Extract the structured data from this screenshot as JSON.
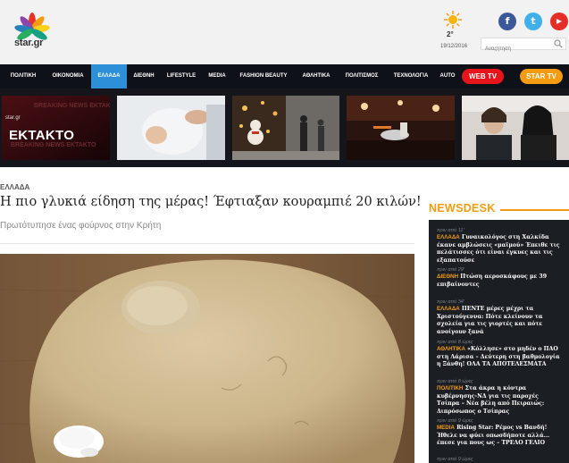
{
  "header": {
    "logo_text": "star.gr",
    "weather": {
      "temp": "2°",
      "date": "19/12/2016"
    },
    "social": {
      "facebook": "f",
      "twitter": "t",
      "youtube": "▶"
    },
    "search": {
      "placeholder": "Αναζήτηση"
    }
  },
  "nav": {
    "items": [
      "ΠΟΛΙΤΙΚΗ",
      "ΟΙΚΟΝΟΜΙΑ",
      "ΕΛΛΑΔΑ",
      "ΔΙΕΘΝΗ",
      "LIFESTYLE",
      "MEDIA",
      "FASHION BEAUTY",
      "ΑΘΛΗΤΙΚΑ",
      "ΠΟΛΙΤΙΣΜΟΣ",
      "ΤΕΧΝΟΛΟΓΙΑ",
      "AUTO"
    ],
    "active": "ΕΛΛΑΔΑ",
    "webtv": "WEB TV",
    "startv": "STAR TV"
  },
  "slider": {
    "breaking_label": "ΕΚΤΑΚΤΟ",
    "breaking_bg_text": "BREAKING NEWS ΕΚΤΑΚΤΟ",
    "logo_text": "star.gr"
  },
  "article": {
    "breadcrumb": "ΕΛΛΑΔΑ",
    "headline": "Η πιο γλυκιά είδηση της μέρας! Έφτιαξαν κουραμπιέ 20 κιλών!",
    "subtitle": "Πρωτότυπησε ένας φούρνος στην Κρήτη"
  },
  "newsdesk": {
    "title": "NEWSDESK",
    "items": [
      {
        "time": "πριν από 11'",
        "category": "ΕΛΛΑΔΑ",
        "text": "Γυναικολόγος στη Χαλκίδα έκανε αμβλώσεις «μαϊμού» Έπειθε τις πελάτισσες ότι είναι έγκυες και τις εξαπατούσε"
      },
      {
        "time": "πριν από 29'",
        "category": "ΔΙΕΘΝΗ",
        "text": "Πτώση αεροσκάφους με 39 επιβαίνοντες"
      },
      {
        "time": "πριν από 34'",
        "category": "ΕΛΛΑΔΑ",
        "text": "ΠΕΝΤΕ μέρες μέχρι τα Χριστούγεννα: Πότε κλείνουν τα σχολεία για τις γιορτές και πότε ανοίγουν ξανά"
      },
      {
        "time": "πριν από 8 ώρες",
        "category": "ΑΘΛΗΤΙΚΑ",
        "text": "«Κόλλησε» στο μηδέν ο ΠΑΟ στη Λάρισα – Δεύτερη στη βαθμολογία η Ξάνθη! ΟΛΑ ΤΑ ΑΠΟΤΕΛΕΣΜΑΤΑ"
      },
      {
        "time": "πριν από 8 ώρες",
        "category": "ΠΟΛΙΤΙΚΗ",
        "text": "Στα άκρα η κόντρα κυβέρνησης-ΝΔ για τις παροχές Τσίπρα – Νέα βέλη από Πειραιώς: Διπρόσωπος ο Τσίπρας"
      },
      {
        "time": "πριν από 9 ώρες",
        "category": "MEDIA",
        "text": "Rising Star: Ρέμος vs Βανδή! Ήθελε να φύει οπωσδήποτε αλλά... έπεσε για πους ως – ΤΡΕΛΟ ΓΕΛΙΟ"
      },
      {
        "time": "πριν από 9 ώρες",
        "category": "",
        "text": ""
      }
    ]
  }
}
